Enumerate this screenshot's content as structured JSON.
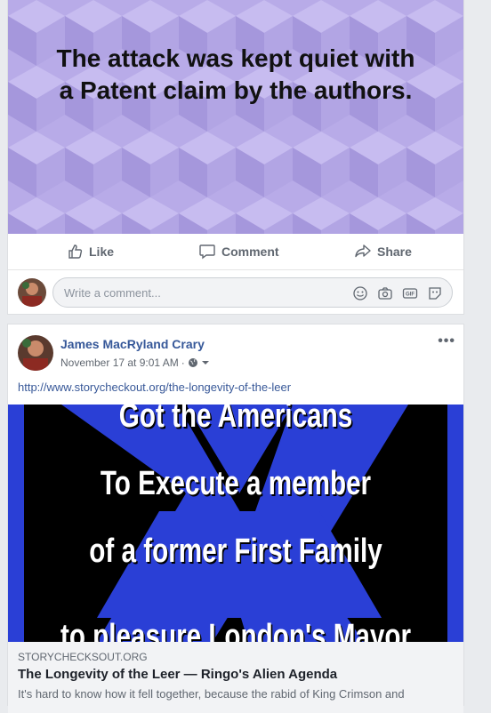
{
  "post1": {
    "panel_text_line1": "The attack was kept quiet with",
    "panel_text_line2": "a Patent claim by the authors.",
    "actions": {
      "like": "Like",
      "comment": "Comment",
      "share": "Share"
    },
    "comment_placeholder": "Write a comment..."
  },
  "post2": {
    "author": "James MacRyland Crary",
    "timestamp": "November 17 at 9:01 AM",
    "url": "http://www.storycheckout.org/the-longevity-of-the-leer",
    "image_lines": {
      "line1": "Got the Americans",
      "line2": "To Execute a member",
      "line3": "of a former First Family",
      "line4": "to pleasure London's Mayor"
    },
    "link_preview": {
      "source": "STORYCHECKSOUT.ORG",
      "title": "The Longevity of the Leer — Ringo's Alien Agenda",
      "description": "It's hard to know how it fell together, because the rabid of King Crimson and"
    }
  },
  "colors": {
    "panel_purple": "#b4a7e6",
    "link_blue": "#385898",
    "author_blue": "#365899",
    "image_blue": "#2a3fd6"
  }
}
